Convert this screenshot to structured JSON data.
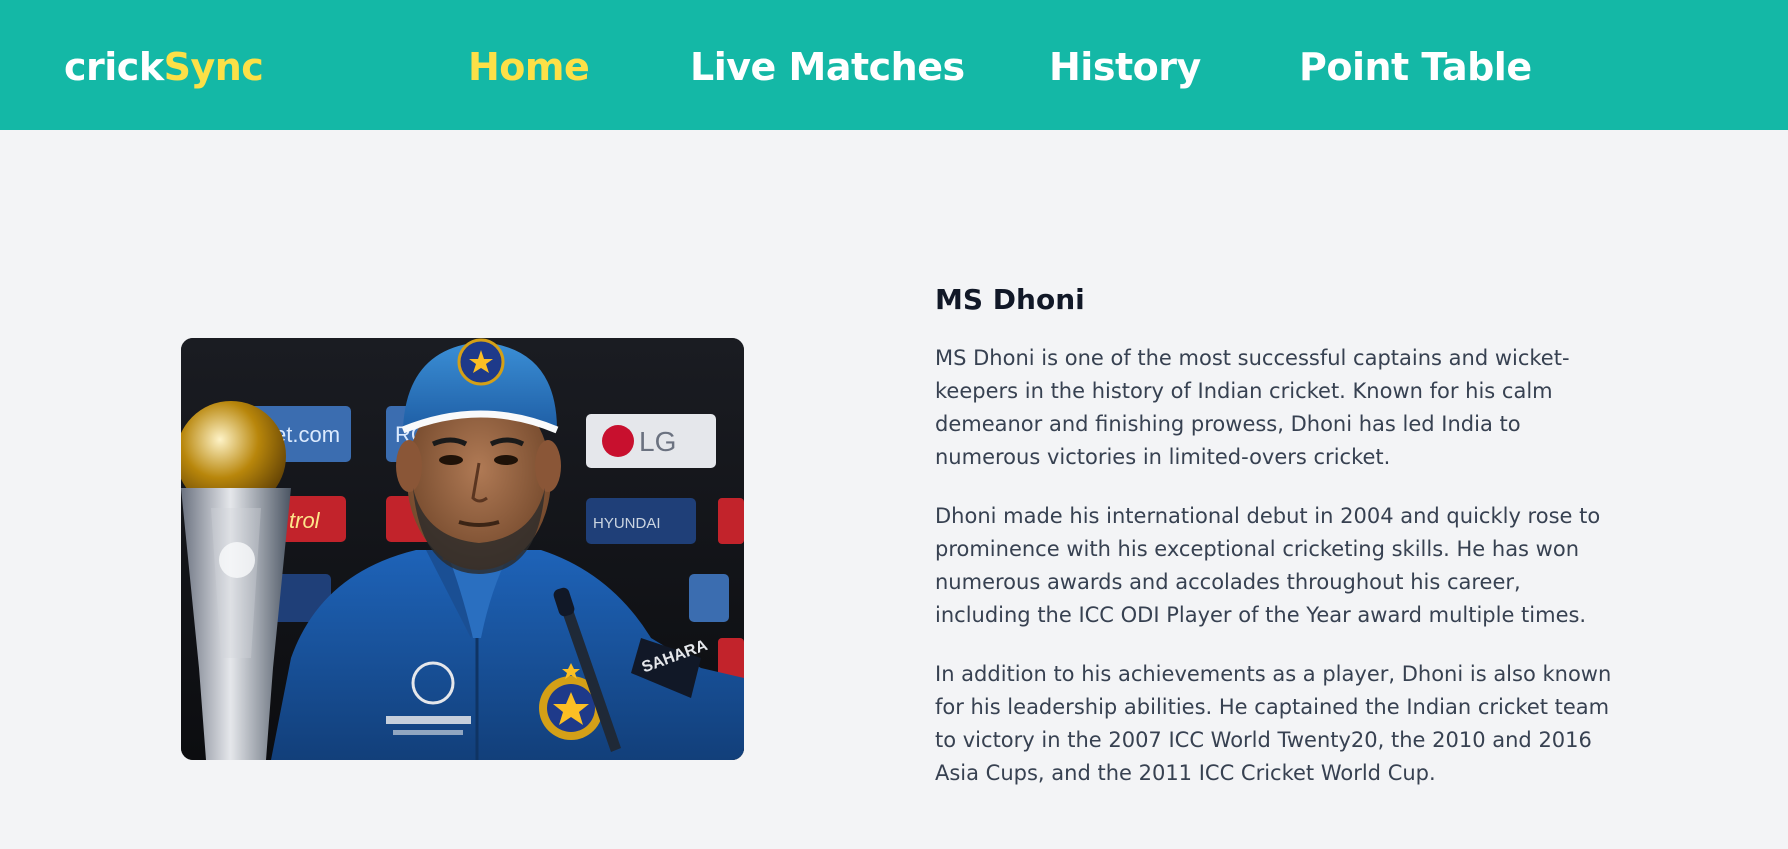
{
  "brand": {
    "name_part1": "crick",
    "name_part2": "Sync"
  },
  "nav": {
    "home": "Home",
    "live": "Live Matches",
    "history": "History",
    "points": "Point Table"
  },
  "colors": {
    "primary": "#14b8a6",
    "accent": "#fde047",
    "background": "#f3f4f6",
    "heading": "#111827",
    "body_text": "#374151"
  },
  "player": {
    "name": "MS Dhoni",
    "paragraphs": [
      "MS Dhoni is one of the most successful captains and wicket-keepers in the history of Indian cricket. Known for his calm demeanor and finishing prowess, Dhoni has led India to numerous victories in limited-overs cricket.",
      "Dhoni made his international debut in 2004 and quickly rose to prominence with his exceptional cricketing skills. He has won numerous awards and accolades throughout his career, including the ICC ODI Player of the Year award multiple times.",
      "In addition to his achievements as a player, Dhoni is also known for his leadership abilities. He captained the Indian cricket team to victory in the 2007 ICC World Twenty20, the 2010 and 2016 Asia Cups, and the 2011 ICC Cricket World Cup."
    ],
    "photo_sponsor_labels": [
      "ket.com",
      "RG",
      "LG",
      "trol",
      "HYUNDAI",
      "SAHARA"
    ]
  }
}
